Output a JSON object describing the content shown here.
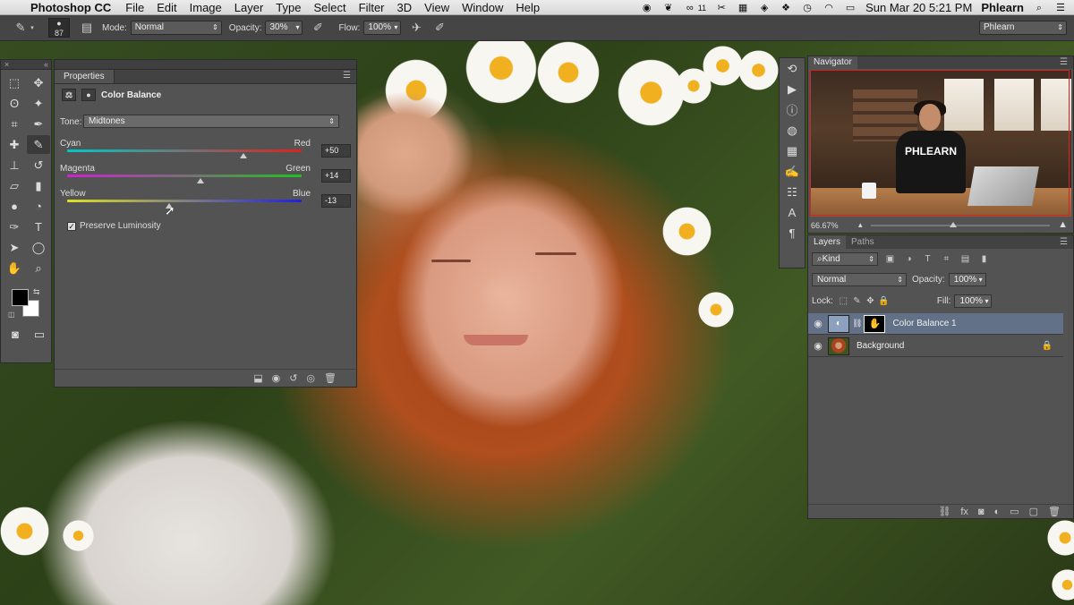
{
  "menubar": {
    "app_name": "Photoshop CC",
    "menus": [
      "File",
      "Edit",
      "Image",
      "Layer",
      "Type",
      "Select",
      "Filter",
      "3D",
      "View",
      "Window",
      "Help"
    ],
    "status_badge": "11",
    "clock": "Sun Mar 20  5:21 PM",
    "user": "Phlearn"
  },
  "options_bar": {
    "brush_size": "87",
    "mode_label": "Mode:",
    "mode_value": "Normal",
    "opacity_label": "Opacity:",
    "opacity_value": "30%",
    "flow_label": "Flow:",
    "flow_value": "100%",
    "workspace": "Phlearn"
  },
  "properties": {
    "tab": "Properties",
    "title": "Color Balance",
    "tone_label": "Tone:",
    "tone_value": "Midtones",
    "sliders": [
      {
        "left": "Cyan",
        "right": "Red",
        "value": "+50",
        "level": 0.75,
        "colors": [
          "#00c8c8",
          "#e02020"
        ]
      },
      {
        "left": "Magenta",
        "right": "Green",
        "value": "+14",
        "level": 0.57,
        "colors": [
          "#d020d0",
          "#20c020"
        ]
      },
      {
        "left": "Yellow",
        "right": "Blue",
        "value": "-13",
        "level": 0.435,
        "colors": [
          "#e0e020",
          "#2020e0"
        ]
      }
    ],
    "preserve_label": "Preserve Luminosity",
    "preserve_checked": true
  },
  "navigator": {
    "tab": "Navigator",
    "zoom": "66.67%",
    "shirt_text": "PHLEARN"
  },
  "layers": {
    "tabs": [
      "Layers",
      "Paths"
    ],
    "filter_value": "Kind",
    "blend_mode": "Normal",
    "opacity_label": "Opacity:",
    "opacity_value": "100%",
    "lock_label": "Lock:",
    "fill_label": "Fill:",
    "fill_value": "100%",
    "items": [
      {
        "name": "Color Balance 1",
        "selected": true
      },
      {
        "name": "Background",
        "selected": false
      }
    ]
  },
  "icons": {
    "tools": [
      "marquee-icon",
      "move-icon",
      "lasso-icon",
      "magic-wand-icon",
      "crop-icon",
      "eyedropper-icon",
      "healing-icon",
      "brush-icon",
      "stamp-icon",
      "history-brush-icon",
      "eraser-icon",
      "gradient-icon",
      "blur-icon",
      "dodge-icon",
      "pen-icon",
      "type-icon",
      "path-select-icon",
      "ellipse-icon",
      "hand-icon",
      "zoom-icon"
    ]
  }
}
